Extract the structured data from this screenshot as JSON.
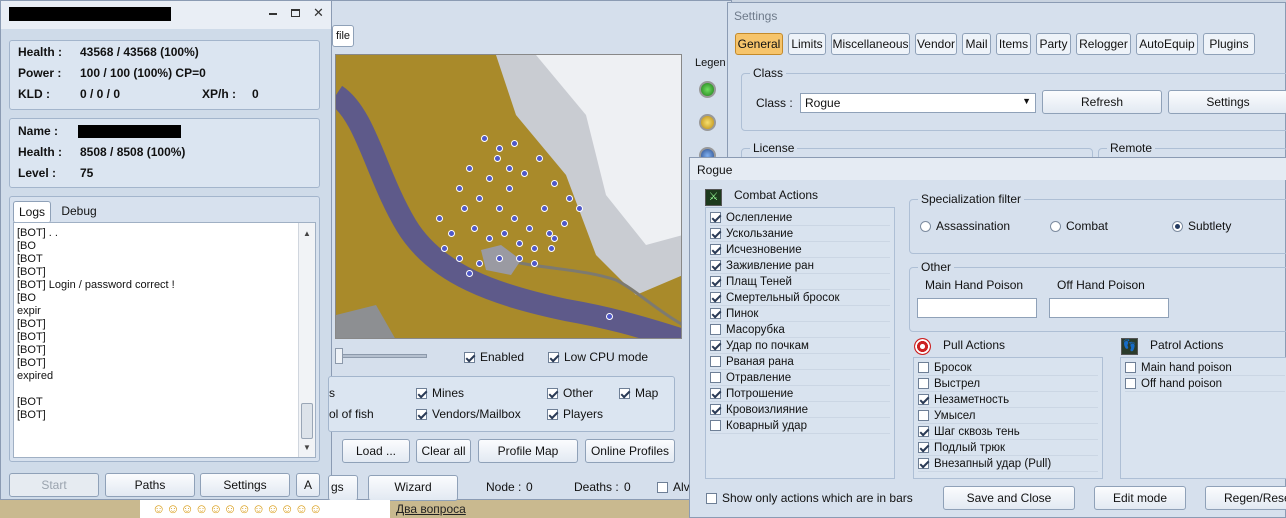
{
  "bot_window": {
    "title_redacted": true,
    "controls": [
      "minimize",
      "restore",
      "close"
    ],
    "stats": {
      "health_label": "Health :",
      "health_value": "43568 / 43568 (100%)",
      "power_label": "Power :",
      "power_value": "100 / 100 (100%) CP=0",
      "kld_label": "KLD :",
      "kld_value": "0 / 0 / 0",
      "xph_label": "XP/h :",
      "xph_value": "0"
    },
    "target": {
      "name_label": "Name :",
      "health_label": "Health :",
      "health_value": "8508 / 8508 (100%)",
      "level_label": "Level :",
      "level_value": "75"
    },
    "tabs": [
      "Logs",
      "Debug"
    ],
    "log_lines": [
      "[BOT] . .",
      "[BO",
      "[BOT",
      "[BOT]",
      "[BOT] Login / password correct !",
      "[BO",
      "expir",
      "[BOT]",
      "[BOT]",
      "[BOT]",
      "[BOT]",
      "expired",
      "",
      "[BOT",
      "[BOT]"
    ],
    "buttons": {
      "start": "Start",
      "paths": "Paths",
      "settings": "Settings",
      "a": "A"
    }
  },
  "map_window": {
    "tab_fragment": "file",
    "legend_label": "Legen",
    "checkbox_enabled": "Enabled",
    "checkbox_low_cpu": "Low CPU mode",
    "filters": {
      "s_fragment": "s",
      "mines": "Mines",
      "other": "Other",
      "map": "Map",
      "pool_fragment": "ol of fish",
      "vendors": "Vendors/Mailbox",
      "players": "Players"
    },
    "buttons": {
      "load": "Load ...",
      "clear_all": "Clear all",
      "profile_map": "Profile Map",
      "online_profiles": "Online Profiles",
      "gs_fragment": "gs",
      "wizard": "Wizard"
    },
    "status": {
      "node_label": "Node :",
      "node_value": "0",
      "deaths_label": "Deaths :",
      "deaths_value": "0",
      "al_fragment": "Alv"
    }
  },
  "settings_window": {
    "title": "Settings",
    "tabs": [
      "General",
      "Limits",
      "Miscellaneous",
      "Vendor",
      "Mail",
      "Items",
      "Party",
      "Relogger",
      "AutoEquip",
      "Plugins"
    ],
    "active_tab": "General",
    "class_group": "Class",
    "class_label": "Class :",
    "class_value": "Rogue",
    "refresh": "Refresh",
    "settings": "Settings",
    "license": "License",
    "remote": "Remote"
  },
  "rogue_window": {
    "title": "Rogue",
    "combat_actions_title": "Combat Actions",
    "combat_actions": [
      {
        "label": "Ослепление",
        "checked": true
      },
      {
        "label": "Ускользание",
        "checked": true
      },
      {
        "label": "Исчезновение",
        "checked": true
      },
      {
        "label": "Заживление ран",
        "checked": true
      },
      {
        "label": "Плащ Теней",
        "checked": true
      },
      {
        "label": "Смертельный бросок",
        "checked": true
      },
      {
        "label": "Пинок",
        "checked": true
      },
      {
        "label": "Масорубка",
        "checked": false
      },
      {
        "label": "Удар по почкам",
        "checked": true
      },
      {
        "label": "Рваная рана",
        "checked": false
      },
      {
        "label": "Отравление",
        "checked": false
      },
      {
        "label": "Потрошение",
        "checked": true
      },
      {
        "label": "Кровоизлияние",
        "checked": true
      },
      {
        "label": "Коварный удар",
        "checked": false
      }
    ],
    "spec_title": "Specialization filter",
    "spec_options": [
      {
        "label": "Assassination",
        "selected": false
      },
      {
        "label": "Combat",
        "selected": false
      },
      {
        "label": "Subtlety",
        "selected": true
      }
    ],
    "other_title": "Other",
    "main_hand_poison": "Main Hand Poison",
    "off_hand_poison": "Off Hand Poison",
    "pull_title": "Pull Actions",
    "pull_actions": [
      {
        "label": "Бросок",
        "checked": false
      },
      {
        "label": "Выстрел",
        "checked": false
      },
      {
        "label": "Незаметность",
        "checked": true
      },
      {
        "label": "Умысел",
        "checked": false
      },
      {
        "label": "Шаг сквозь тень",
        "checked": true
      },
      {
        "label": "Подлый трюк",
        "checked": true
      },
      {
        "label": "Внезапный удар (Pull)",
        "checked": true
      }
    ],
    "patrol_title": "Patrol Actions",
    "patrol_actions": [
      {
        "label": "Main hand poison",
        "checked": false
      },
      {
        "label": "Off hand poison",
        "checked": false
      }
    ],
    "show_only_label": "Show only actions which are in bars",
    "buttons": {
      "save_close": "Save and Close",
      "edit_mode": "Edit mode",
      "regen": "Regen/Reset"
    }
  },
  "taskbar": {
    "chat_fragment": "Два вопроса"
  }
}
